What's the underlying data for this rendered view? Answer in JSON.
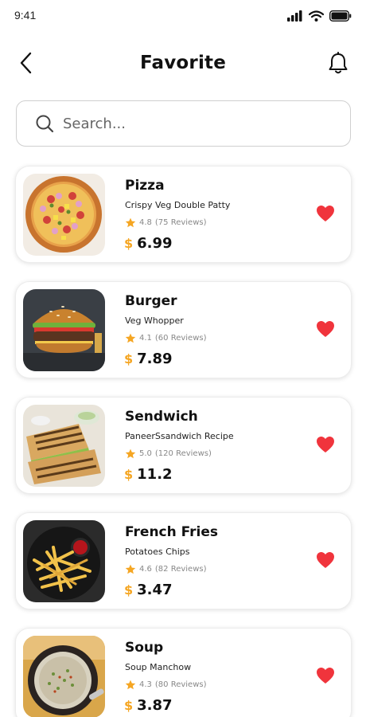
{
  "status_bar": {
    "time": "9:41",
    "icons": [
      "signal-icon",
      "wifi-icon",
      "battery-icon"
    ]
  },
  "header": {
    "title": "Favorite",
    "back_icon": "back-arrow-icon",
    "notification_icon": "bell-icon"
  },
  "search": {
    "placeholder": "Search...",
    "value": ""
  },
  "colors": {
    "accent": "#f5a623",
    "heart": "#f0343c",
    "star": "#f5a623"
  },
  "items": [
    {
      "name": "Pizza",
      "description": "Crispy Veg Double Patty",
      "rating": "4.8",
      "reviews": "(75 Reviews)",
      "currency": "$",
      "price": "6.99",
      "favorite": true
    },
    {
      "name": "Burger",
      "description": "Veg Whopper",
      "rating": "4.1",
      "reviews": "(60 Reviews)",
      "currency": "$",
      "price": "7.89",
      "favorite": true
    },
    {
      "name": "Sendwich",
      "description": "PaneerSsandwich Recipe",
      "rating": "5.0",
      "reviews": "(120 Reviews)",
      "currency": "$",
      "price": "11.2",
      "favorite": true
    },
    {
      "name": "French Fries",
      "description": "Potatoes Chips",
      "rating": "4.6",
      "reviews": "(82 Reviews)",
      "currency": "$",
      "price": "3.47",
      "favorite": true
    },
    {
      "name": "Soup",
      "description": "Soup Manchow",
      "rating": "4.3",
      "reviews": "(80 Reviews)",
      "currency": "$",
      "price": "3.87",
      "favorite": true
    }
  ]
}
